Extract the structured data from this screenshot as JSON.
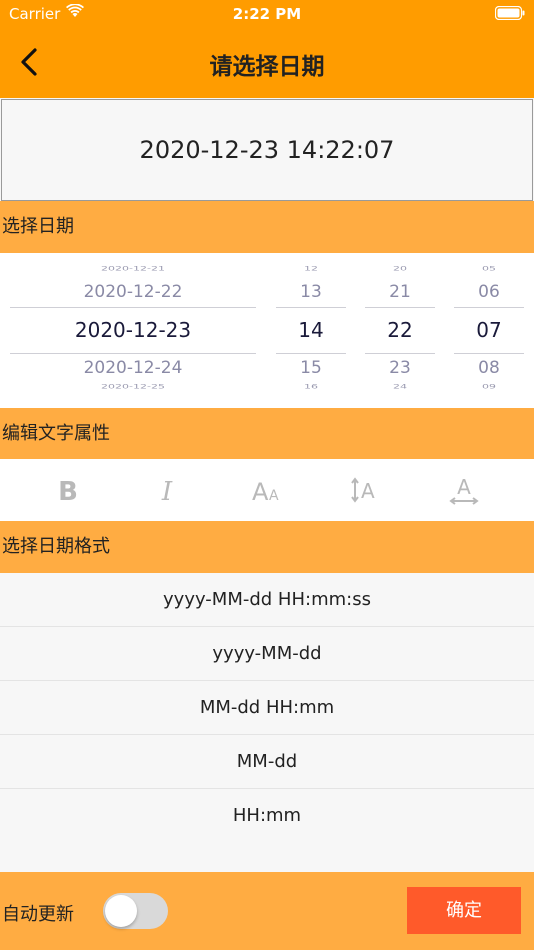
{
  "status_bar": {
    "carrier": "Carrier",
    "time": "2:22 PM"
  },
  "header": {
    "title": "请选择日期",
    "back_icon": "chevron-left-icon"
  },
  "display": {
    "value": "2020-12-23 14:22:07"
  },
  "sections": {
    "date": "选择日期",
    "text_attrs": "编辑文字属性",
    "format": "选择日期格式"
  },
  "picker": {
    "date": {
      "far_top": "2020-12-21",
      "near_top": "2020-12-22",
      "selected": "2020-12-23",
      "near_bottom": "2020-12-24",
      "far_bottom": "2020-12-25"
    },
    "hour": {
      "far_top": "12",
      "near_top": "13",
      "selected": "14",
      "near_bottom": "15",
      "far_bottom": "16"
    },
    "minute": {
      "far_top": "20",
      "near_top": "21",
      "selected": "22",
      "near_bottom": "23",
      "far_bottom": "24"
    },
    "second": {
      "far_top": "05",
      "near_top": "06",
      "selected": "07",
      "near_bottom": "08",
      "far_bottom": "09"
    }
  },
  "toolbar": {
    "icons": [
      "bold-icon",
      "italic-icon",
      "font-size-icon",
      "line-height-icon",
      "letter-spacing-icon"
    ],
    "icon_color": "#b9b9b9"
  },
  "formats": [
    "yyyy-MM-dd HH:mm:ss",
    "yyyy-MM-dd",
    "MM-dd HH:mm",
    "MM-dd",
    "HH:mm"
  ],
  "footer": {
    "auto_update_label": "自动更新",
    "auto_update_on": false,
    "confirm_label": "确定"
  },
  "colors": {
    "nav": "#ff9c00",
    "section": "#ffac42",
    "confirm": "#ff5a2a"
  }
}
